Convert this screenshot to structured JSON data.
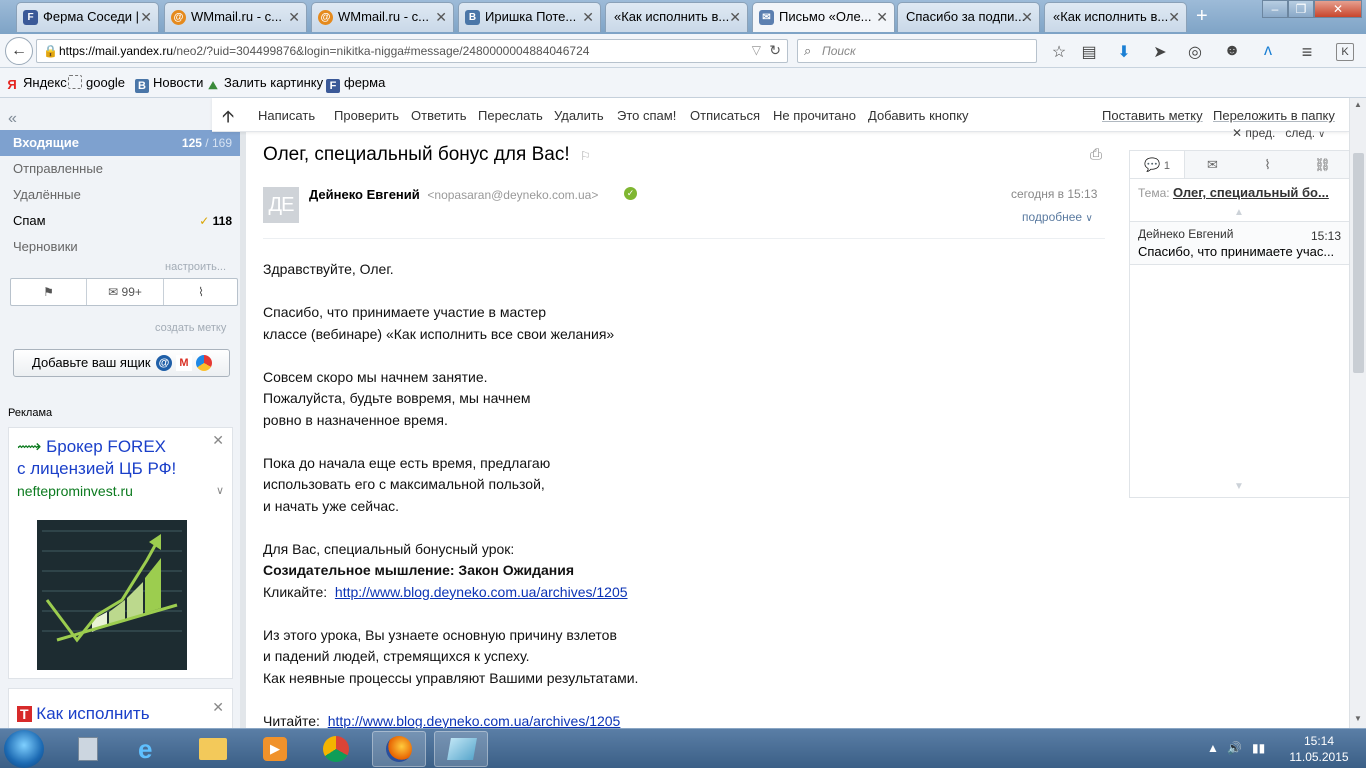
{
  "browser": {
    "tabs": [
      {
        "label": "Ферма Соседи |",
        "icon": "facebook-f-icon",
        "color": "#3b5998"
      },
      {
        "label": "WMmail.ru - с...",
        "icon": "wmmail-icon",
        "color": "#e58a1d"
      },
      {
        "label": "WMmail.ru - с...",
        "icon": "wmmail-icon",
        "color": "#e58a1d"
      },
      {
        "label": "Иришка Поте...",
        "icon": "vk-icon",
        "color": "#4a76a8"
      },
      {
        "label": "«Как исполнить в...",
        "icon": "page-icon",
        "color": "#888888"
      },
      {
        "label": "Письмо «Оле...",
        "icon": "mail-icon",
        "color": "#5b7fb0"
      },
      {
        "label": "Спасибо за подпи...",
        "icon": "page-icon",
        "color": "#888888"
      },
      {
        "label": "«Как исполнить в...",
        "icon": "page-icon",
        "color": "#888888"
      }
    ],
    "new_tab": "+",
    "url_host": "https://mail.yandex.ru",
    "url_path": "/neo2/?uid=304499876&login=nikitka-nigga#message/2480000004884046724",
    "search_placeholder": "Поиск",
    "bookmarks": [
      "Яндекс",
      "google",
      "Новости",
      "Залить картинку",
      "ферма"
    ]
  },
  "sidebar": {
    "folders": [
      {
        "label": "Входящие",
        "unread": "125",
        "total": "169"
      },
      {
        "label": "Отправленные"
      },
      {
        "label": "Удалённые"
      },
      {
        "label": "Спам",
        "count": "118"
      },
      {
        "label": "Черновики"
      }
    ],
    "settings_link": "настроить...",
    "unread_badge": "99+",
    "create_label": "создать метку",
    "add_mailbox": "Добавьте ваш ящик",
    "ad_label": "Реклама",
    "ad1": {
      "title_line1": "Брокер FOREX",
      "title_line2": "с лицензией ЦБ РФ!",
      "domain": "nefteprominvest.ru"
    },
    "ad2": {
      "title": "Как исполнить"
    }
  },
  "toolbar": {
    "items": [
      "Написать",
      "Проверить",
      "Ответить",
      "Переслать",
      "Удалить",
      "Это спам!",
      "Отписаться",
      "Не прочитано",
      "Добавить кнопку"
    ],
    "right": [
      "Поставить метку",
      "Переложить в папку"
    ]
  },
  "message": {
    "subject": "Олег, специальный бонус для Вас!",
    "avatar_initials": "ДЕ",
    "sender_name": "Дейнеко Евгений",
    "sender_email": "<nopasaran@deyneko.com.ua>",
    "date": "сегодня в 15:13",
    "details": "подробнее",
    "body": {
      "greeting": "Здравствуйте, Олег.",
      "p1_l1": "Спасибо, что принимаете участие в мастер",
      "p1_l2": "классе (вебинаре) «Как исполнить все свои желания»",
      "p2_l1": "Совсем скоро мы начнем занятие.",
      "p2_l2": "Пожалуйста, будьте вовремя, мы начнем",
      "p2_l3": "ровно в назначенное время.",
      "p3_l1": "Пока до начала еще есть время, предлагаю",
      "p3_l2": "использовать его с максимальной пользой,",
      "p3_l3": "и начать уже сейчас.",
      "p4_l1": "Для Вас, специальный бонусный урок:",
      "p4_bold": "Созидательное мышление: Закон Ожидания",
      "p4_click_label": "Кликайте:",
      "p4_link": "http://www.blog.deyneko.com.ua/archives/1205",
      "p5_l1": "Из этого урока, Вы узнаете основную причину взлетов",
      "p5_l2": "и падений людей, стремящихся к успеху.",
      "p5_l3": "Как неявные процессы управляют Вашими результатами.",
      "p6_label": "Читайте:",
      "p6_link": "http://www.blog.deyneko.com.ua/archives/1205"
    }
  },
  "thread": {
    "prev": "пред.",
    "next": "след.",
    "conversation_count": "1",
    "topic_label": "Тема:",
    "topic_value": "Олег, специальный бо...",
    "item_sender": "Дейнеко Евгений",
    "item_time": "15:13",
    "item_snippet": "Спасибо, что принимаете учас..."
  },
  "taskbar": {
    "time": "15:14",
    "date": "11.05.2015"
  }
}
